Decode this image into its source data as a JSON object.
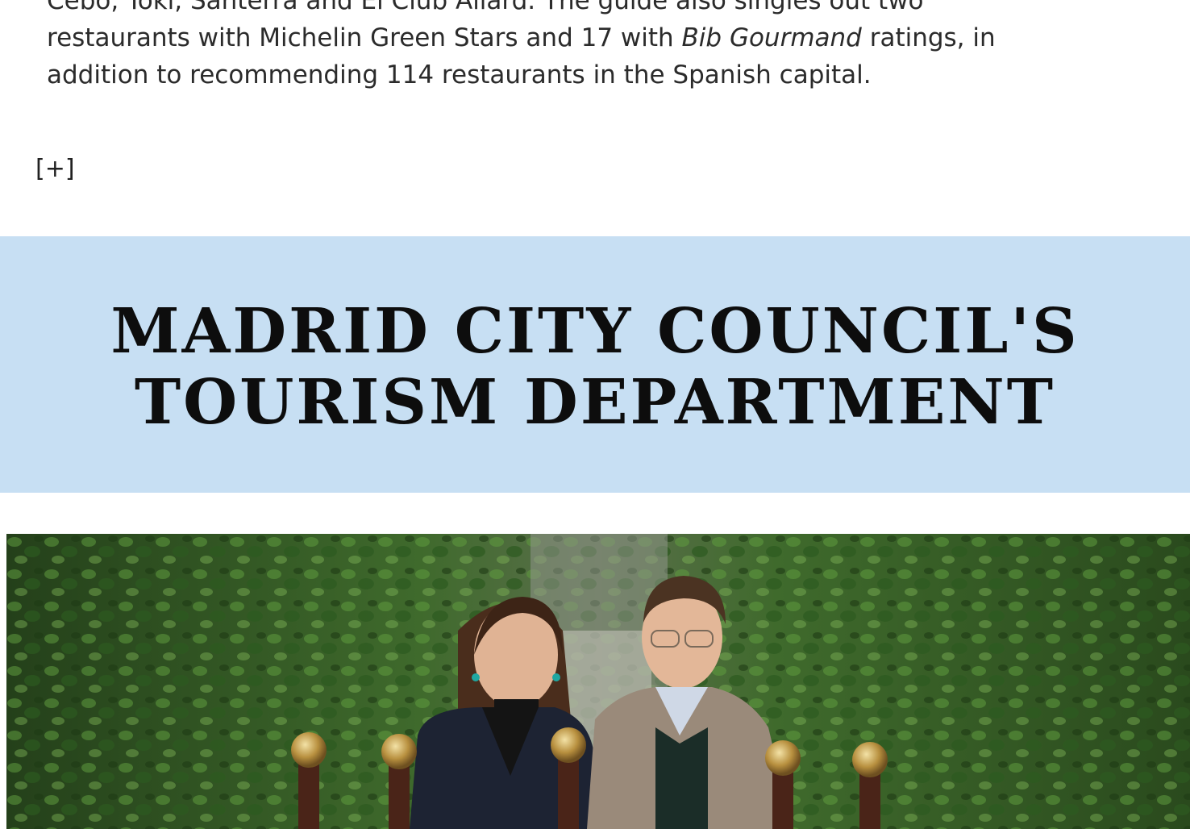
{
  "article": {
    "intro_line1": "Cebo, Toki, Santerra and El Club Allard. The guide also singles out two",
    "intro_line2_a": "restaurants with Michelin Green Stars and 17 with ",
    "intro_line2_em": "Bib Gourmand",
    "intro_line2_b": " ratings, in",
    "intro_line3": "addition to recommending 114 restaurants in the Spanish capital.",
    "expand_label": "[+]"
  },
  "banner": {
    "line1": "Madrid City Council's",
    "line2": "Tourism Department",
    "background_color": "#c7dff3"
  },
  "photo": {
    "subject": "photo-two-people-with-award-trophies"
  }
}
